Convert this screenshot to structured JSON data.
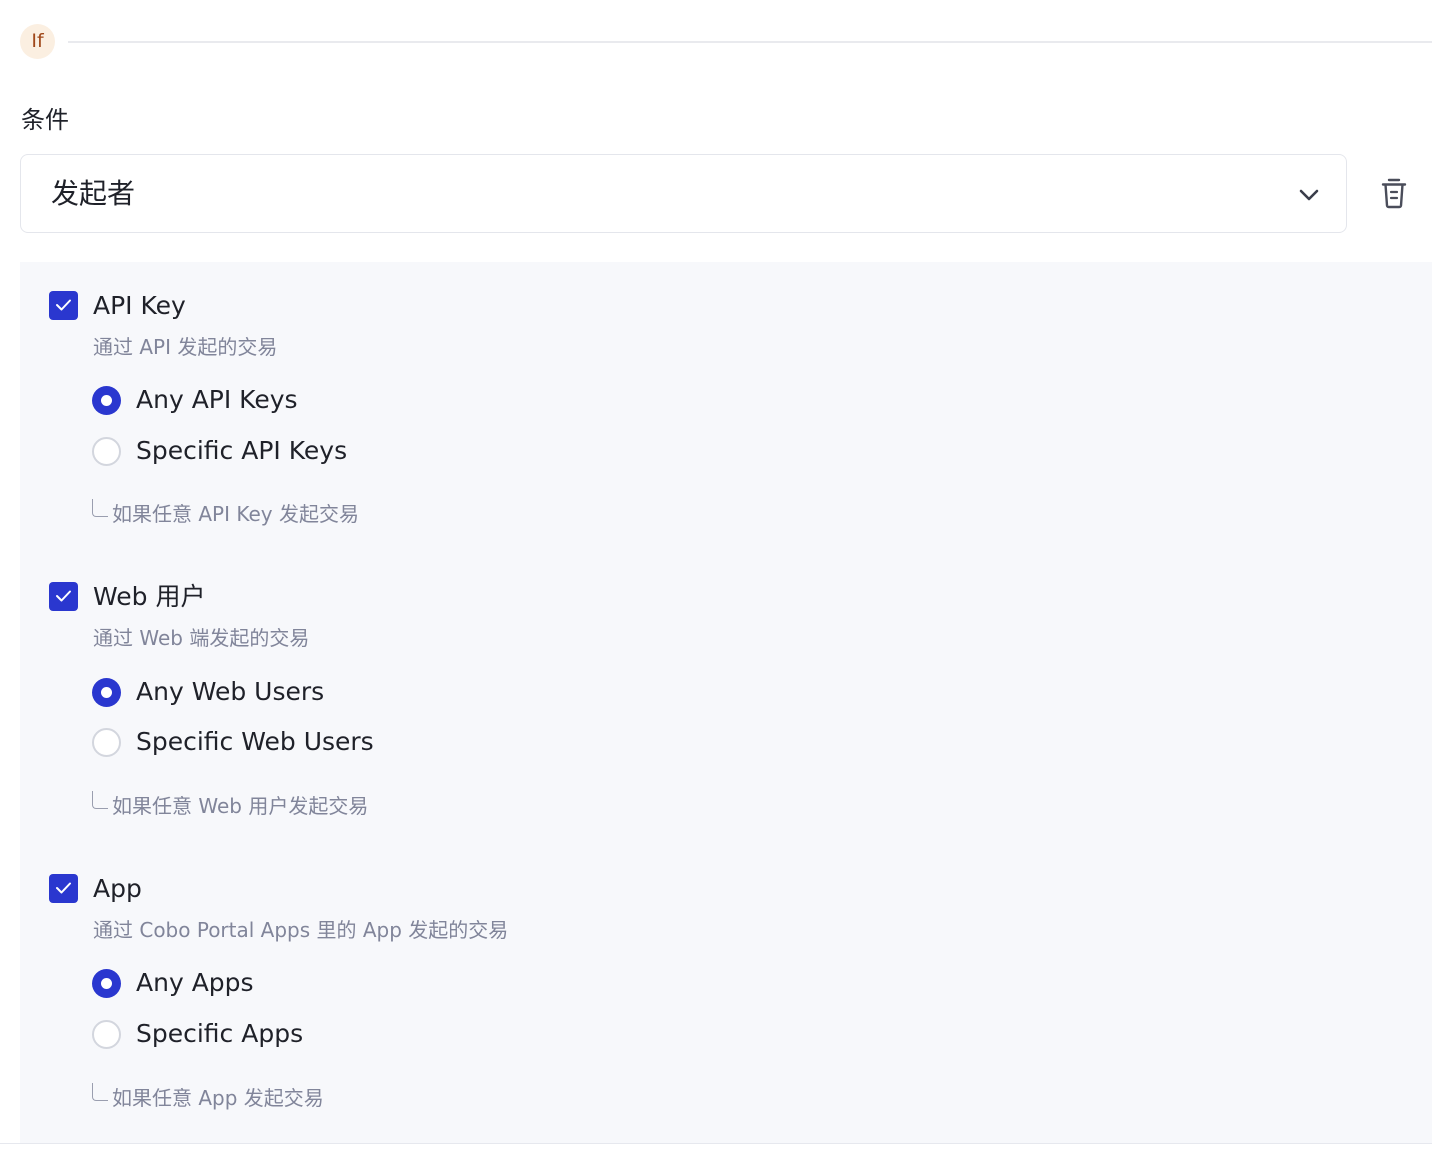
{
  "header": {
    "if_label": "If"
  },
  "condition": {
    "label": "条件",
    "selected_value": "发起者"
  },
  "groups": [
    {
      "title": "API Key",
      "description": "通过 API 发起的交易",
      "checked": true,
      "options": [
        {
          "label": "Any API Keys",
          "selected": true
        },
        {
          "label": "Specific API Keys",
          "selected": false
        }
      ],
      "hint": "如果任意 API Key 发起交易"
    },
    {
      "title": "Web 用户",
      "description": "通过 Web 端发起的交易",
      "checked": true,
      "options": [
        {
          "label": "Any Web Users",
          "selected": true
        },
        {
          "label": "Specific Web Users",
          "selected": false
        }
      ],
      "hint": "如果任意 Web 用户发起交易"
    },
    {
      "title": "App",
      "description": "通过 Cobo Portal Apps 里的 App 发起的交易",
      "checked": true,
      "options": [
        {
          "label": "Any Apps",
          "selected": true
        },
        {
          "label": "Specific Apps",
          "selected": false
        }
      ],
      "hint": "如果任意 App 发起交易"
    }
  ],
  "icons": {
    "chevron": "chevron-down-icon",
    "delete": "trash-icon",
    "check": "checkmark-icon"
  },
  "colors": {
    "accent": "#2a37cf",
    "if_badge_bg": "#fbefe1",
    "if_badge_text": "#a0481a",
    "muted_text": "#81859a",
    "panel_bg": "#f7f8fb"
  }
}
